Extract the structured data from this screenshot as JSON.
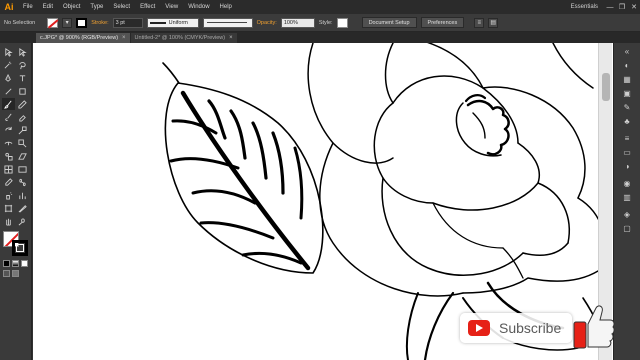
{
  "app": {
    "logo": "Ai",
    "menus": [
      "File",
      "Edit",
      "Object",
      "Type",
      "Select",
      "Effect",
      "View",
      "Window",
      "Help"
    ],
    "workspace": "Essentials",
    "window_buttons": [
      "—",
      "❐",
      "✕"
    ]
  },
  "control": {
    "selection": "No Selection",
    "stroke_label": "Stroke:",
    "stroke_weight": "3 pt",
    "profile": "Uniform",
    "opacity_label": "Opacity:",
    "opacity": "100%",
    "style_label": "Style:",
    "document_setup": "Document Setup",
    "preferences": "Preferences"
  },
  "tabs": [
    {
      "label": "c.JPG* @ 900% (RGB/Preview)",
      "close": "×",
      "active": true
    },
    {
      "label": "Untitled-2* @ 100% (CMYK/Preview)",
      "close": "×",
      "active": false
    }
  ],
  "tools": [
    "selection-tool",
    "direct-selection-tool",
    "magic-wand-tool",
    "lasso-tool",
    "pen-tool",
    "type-tool",
    "line-tool",
    "rectangle-tool",
    "paintbrush-tool",
    "pencil-tool",
    "blob-brush-tool",
    "eraser-tool",
    "rotate-tool",
    "scale-tool",
    "width-tool",
    "free-transform-tool",
    "shape-builder-tool",
    "perspective-tool",
    "mesh-tool",
    "gradient-tool",
    "eyedropper-tool",
    "blend-tool",
    "symbol-sprayer-tool",
    "column-graph-tool",
    "artboard-tool",
    "slice-tool",
    "hand-tool",
    "zoom-tool"
  ],
  "overlay": {
    "subscribe_label": "Subscribe"
  },
  "colors": {
    "ui_dark": "#323232",
    "accent_orange": "#ff9a00",
    "youtube_red": "#e62117"
  }
}
